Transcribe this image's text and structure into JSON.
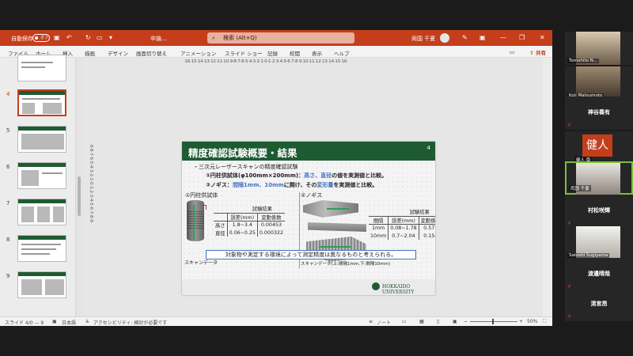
{
  "titlebar": {
    "autosave_label": "自動保存",
    "autosave_state": "オフ",
    "doc_name": "卒論…",
    "search_placeholder": "検索 (Alt+Q)",
    "user_name": "両国 千夏",
    "accent": "#c43e1c"
  },
  "tabs": [
    "ファイル",
    "ホーム",
    "挿入",
    "描画",
    "デザイン",
    "画面切り替え",
    "アニメーション",
    "スライド ショー",
    "記録",
    "校閲",
    "表示",
    "ヘルプ"
  ],
  "share_label": "共有",
  "thumbnails": [
    {
      "num": "4",
      "active": true
    },
    {
      "num": "5",
      "active": false
    },
    {
      "num": "6",
      "active": false
    },
    {
      "num": "7",
      "active": false
    },
    {
      "num": "8",
      "active": false
    },
    {
      "num": "9",
      "active": false
    }
  ],
  "rulers": {
    "horizontal": "·16·15·14·13·12·11·10·9·8·7·6·5·4·3·2·1·0·1·2·3·4·5·6·7·8·9·10·11·12·13·14·15·16·",
    "vertical": "·9·8·7·6·5·4·3·2·1·0·1·2·3·4·5·6·7·8·9·"
  },
  "slide": {
    "title": "精度確認試験概要・結果",
    "number": "4",
    "bullet_main": "・三次元レーザースキャンの精度確認試験",
    "item1": {
      "prefix": "①円柱供試体(φ100mm×200mm)：",
      "hl1": "高さ、直径",
      "suffix": "の値を実測値と比較。"
    },
    "item2": {
      "prefix": "②ノギス：",
      "hl1": "間隔1mm、10mm",
      "mid": "に開け、その",
      "hl2": "変形量",
      "suffix": "を実測値と比較。"
    },
    "left_heading": "①円柱供試体",
    "right_heading": "②ノギス",
    "left_caption": "スキャンデータ",
    "right_caption": "スキャンデータ(上:間隔1mm,下:間隔10mm)",
    "table_left": {
      "title": "試験結果",
      "headers": [
        "",
        "誤差(mm)",
        "変動係数"
      ],
      "rows": [
        [
          "高さ",
          "1.8~3.4",
          "0.00453"
        ],
        [
          "直径",
          "0.06~0.25",
          "0.000322"
        ]
      ]
    },
    "table_right": {
      "title": "試験結果",
      "headers": [
        "間隔",
        "誤差(mm)",
        "変動係数"
      ],
      "rows": [
        [
          "1mm",
          "0.08~1.78",
          "0.577"
        ],
        [
          "10mm",
          "0.7~2.04",
          "0.154"
        ]
      ]
    },
    "conclusion": "対象物や測定する環境によって測定精度は異なるものと考えられる。",
    "footer": "HOKKAIDO UNIVERSITY",
    "header_color": "#1e5b32",
    "highlight_color": "#4472c4"
  },
  "statusbar": {
    "slide_info": "スライド 4/0 — 9",
    "language": "日本語",
    "accessibility": "アクセシビリティ: 検討が必要です",
    "notes": "ノート",
    "zoom": "50%"
  },
  "participants": [
    {
      "label": "Tomohito N...",
      "type": "video"
    },
    {
      "label": "Koji Matsumoto",
      "type": "video"
    },
    {
      "label": "神谷奏有",
      "type": "name"
    },
    {
      "label": "健人 南",
      "type": "avatar",
      "initial": "健人"
    },
    {
      "label": "両国 千夏",
      "type": "video",
      "speaking": true
    },
    {
      "label": "村松咲輝",
      "type": "name"
    },
    {
      "label": "Satoshi Sugiyama",
      "type": "video"
    },
    {
      "label": "渡邊晴哉",
      "type": "name"
    },
    {
      "label": "清宮昂",
      "type": "name"
    }
  ]
}
